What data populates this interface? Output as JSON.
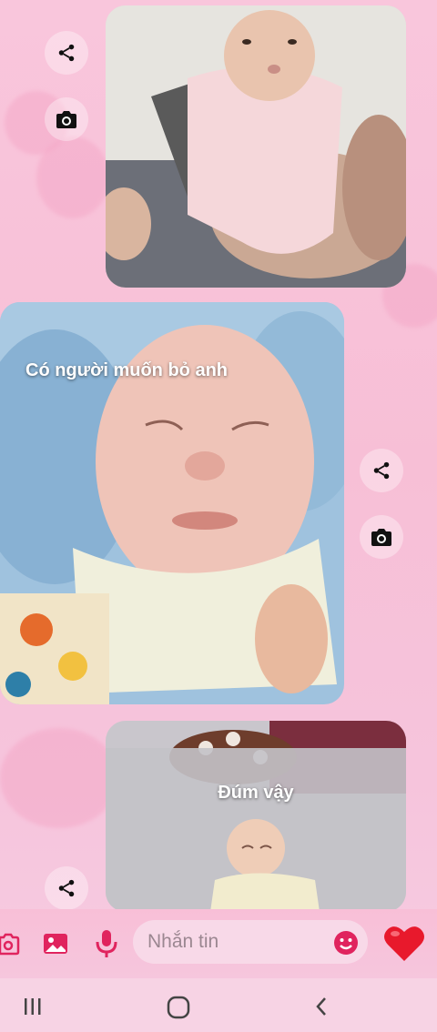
{
  "chat": {
    "messages": [
      {
        "type": "photo",
        "caption": ""
      },
      {
        "type": "photo",
        "caption": "Có người muốn bỏ anh"
      },
      {
        "type": "photo",
        "caption": "Đúm vậy"
      }
    ],
    "actions": {
      "share_icon": "share-icon",
      "camera_icon": "camera-icon"
    }
  },
  "composer": {
    "placeholder": "Nhắn tin",
    "icons": [
      "camera-icon",
      "gallery-icon",
      "microphone-icon",
      "emoji-icon",
      "heart-icon"
    ]
  },
  "navbar": {
    "icons": [
      "recent-apps-icon",
      "home-icon",
      "back-icon"
    ]
  },
  "colors": {
    "accent": "#e0245e",
    "heart": "#e8192c",
    "background": "#f7c4db"
  }
}
